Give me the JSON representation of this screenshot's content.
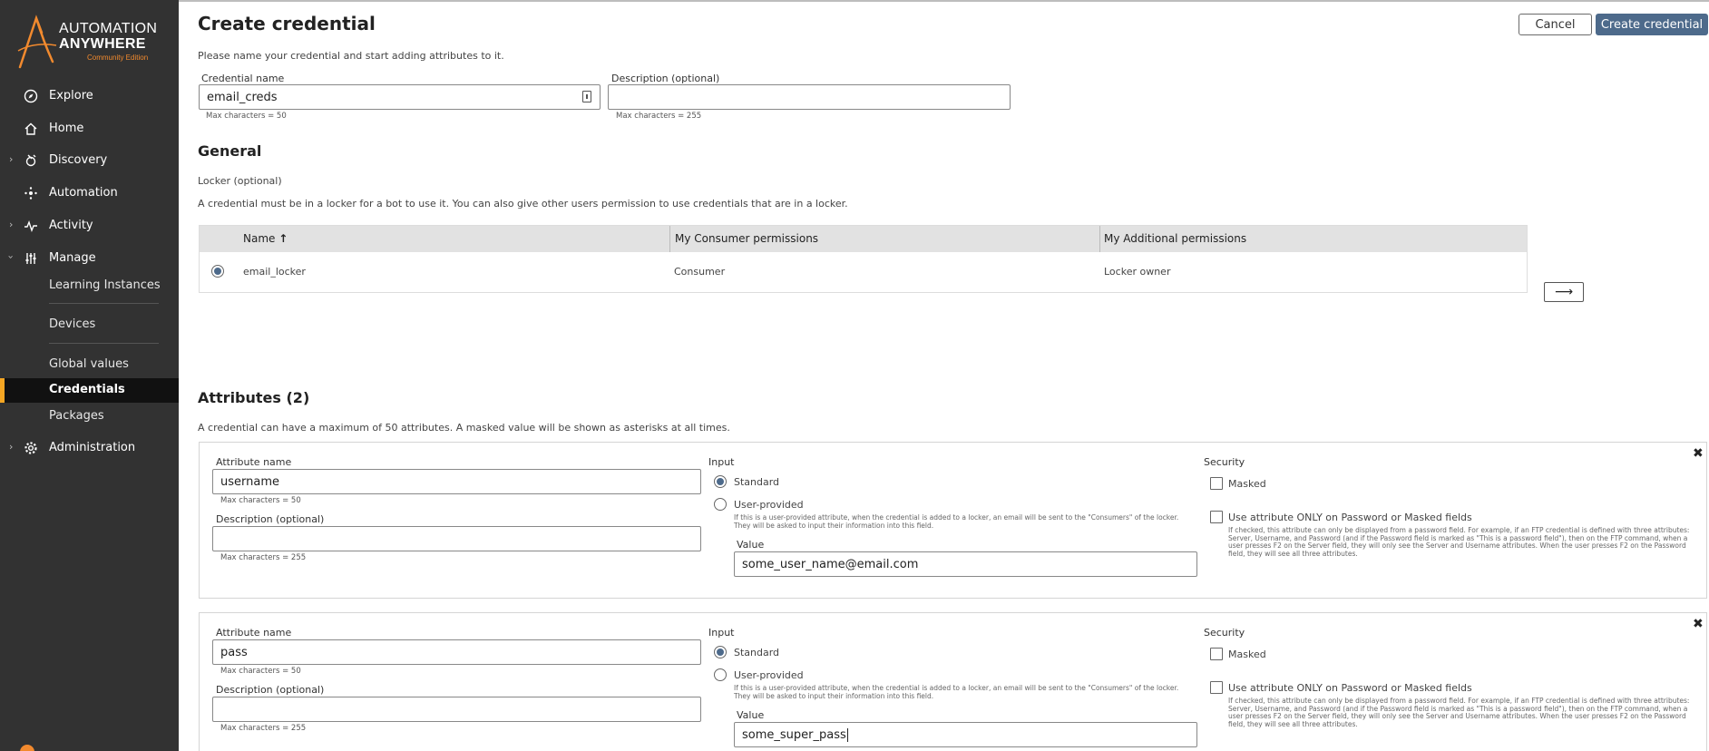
{
  "app": {
    "logo_line1": "AUTOMATION",
    "logo_line2": "ANYWHERE",
    "logo_line3": "Community Edition",
    "accent_color": "#f5a623",
    "primary_color": "#4d6a8b"
  },
  "sidebar": {
    "items": [
      {
        "label": "Explore",
        "icon": "compass-icon"
      },
      {
        "label": "Home",
        "icon": "home-icon"
      },
      {
        "label": "Discovery",
        "icon": "discovery-icon"
      },
      {
        "label": "Automation",
        "icon": "automation-icon"
      },
      {
        "label": "Activity",
        "icon": "activity-icon"
      },
      {
        "label": "Manage",
        "icon": "sliders-icon"
      },
      {
        "label": "Administration",
        "icon": "gear-icon"
      }
    ],
    "manage_sub": [
      "Learning Instances",
      "Devices",
      "Global values",
      "Credentials",
      "Packages"
    ]
  },
  "header": {
    "title": "Create credential",
    "cancel_label": "Cancel",
    "create_label": "Create credential",
    "intro": "Please name your credential and start adding attributes to it."
  },
  "form": {
    "name_label": "Credential name",
    "name_value": "email_creds",
    "name_hint": "Max characters = 50",
    "desc_label": "Description (optional)",
    "desc_value": "",
    "desc_hint": "Max characters = 255"
  },
  "general": {
    "heading": "General",
    "locker_label": "Locker (optional)",
    "locker_help": "A credential must be in a locker for a bot to use it. You can also give other users permission to use credentials that are in a locker.",
    "columns": [
      "Name",
      "My Consumer permissions",
      "My Additional permissions"
    ],
    "sort_indicator": "↑",
    "rows": [
      {
        "name": "email_locker",
        "consumer": "Consumer",
        "additional": "Locker owner",
        "selected": true
      }
    ],
    "arrow": "⟶"
  },
  "attributes": {
    "heading": "Attributes (2)",
    "help": "A credential can have a maximum of 50 attributes. A masked value will be shown as asterisks at all times.",
    "attr_name_label": "Attribute name",
    "attr_name_hint": "Max characters = 50",
    "desc_label": "Description (optional)",
    "desc_hint": "Max characters = 255",
    "input_label": "Input",
    "standard_label": "Standard",
    "user_provided_label": "User-provided",
    "user_provided_help": "If this is a user-provided attribute, when the credential is added to a locker, an email will be sent to the \"Consumers\" of the locker. They will be asked to input their information into this field.",
    "value_label": "Value",
    "security_label": "Security",
    "masked_label": "Masked",
    "password_only_label": "Use attribute ONLY on Password or Masked fields",
    "password_only_help": "If checked, this attribute can only be displayed from a password field. For example, if an FTP credential is defined with three attributes: Server, Username, and Password (and if the Password field is marked as \"This is a password field\"), then on the FTP command, when a user presses F2 on the Server field, they will only see the Server and Username attributes. When the user presses F2 on the Password field, they will see all three attributes.",
    "close": "✖",
    "items": [
      {
        "name": "username",
        "description": "",
        "input": "Standard",
        "value": "some_user_name@email.com",
        "masked": false,
        "password_only": false
      },
      {
        "name": "pass",
        "description": "",
        "input": "Standard",
        "value": "some_super_pass",
        "masked": false,
        "password_only": false
      }
    ]
  }
}
